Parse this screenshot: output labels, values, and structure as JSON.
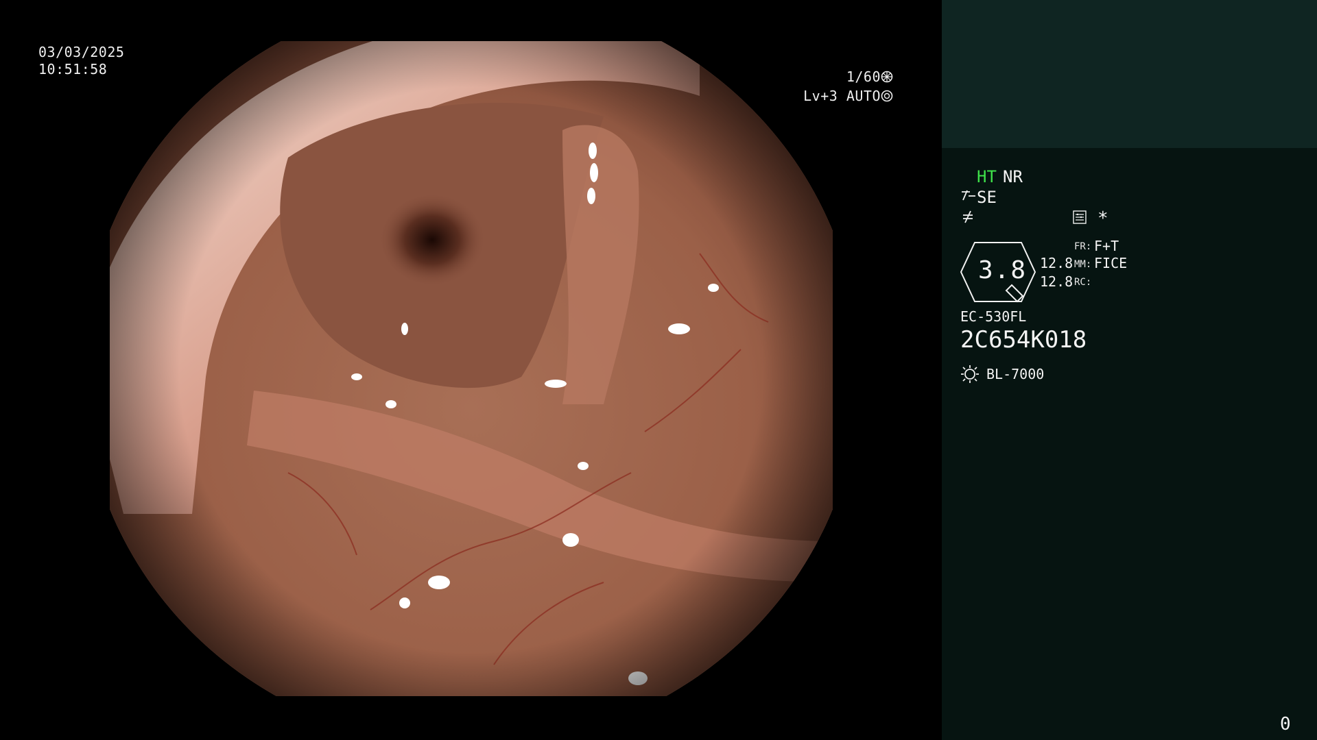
{
  "overlay": {
    "date": "03/03/2025",
    "time": "10:51:58",
    "shutter": "1/60",
    "level": "Lv+3",
    "iris_mode": "AUTO"
  },
  "side_panel": {
    "ht": "HT",
    "nr": "NR",
    "se": "SE",
    "zoom_value": "3.8",
    "val1": "12.8",
    "val2": "12.8",
    "fr_label": "FR:",
    "fr_value": "F+T",
    "mm_label": "MM:",
    "mm_value": "FICE",
    "rc_label": "RC:",
    "scope_model": "EC-530FL",
    "scope_serial": "2C654K018",
    "light_source": "BL-7000",
    "counter": "0",
    "star": "*"
  },
  "colors": {
    "panel_bg": "#061411",
    "panel_top_bg": "#0f2522",
    "ht_green": "#3fe34a"
  },
  "icons": [
    "shutter-icon",
    "iris-icon",
    "structure-enhance-icon",
    "color-enhance-icon",
    "record-icon",
    "light-source-icon",
    "zoom-hexagon-icon"
  ]
}
